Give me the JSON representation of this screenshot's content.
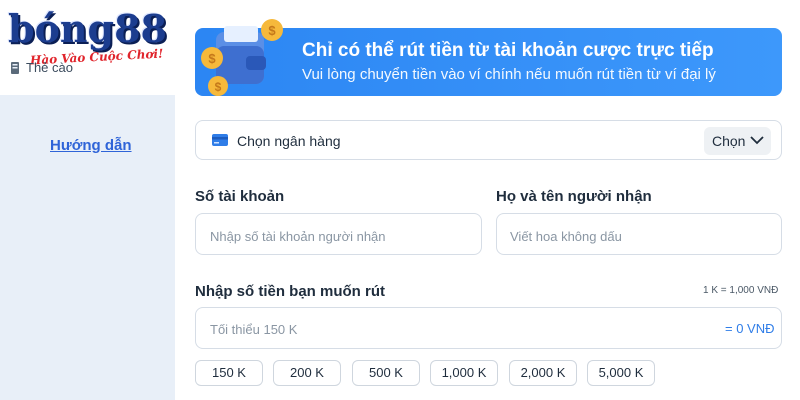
{
  "brand": {
    "logo_text": "bóng88",
    "slogan": "Hào Vào Cuộc Chơi!"
  },
  "sidebar": {
    "card_item_label": "Thẻ cào",
    "help_link": "Hướng dẫn"
  },
  "banner": {
    "title": "Chỉ có thể rút tiền từ tài khoản cược trực tiếp",
    "subtitle": "Vui lòng chuyển tiền vào ví chính nếu muốn rút tiền từ ví đại lý"
  },
  "bank": {
    "label": "Chọn ngân hàng",
    "choose_button": "Chọn"
  },
  "account": {
    "label": "Số tài khoản",
    "placeholder": "Nhập số tài khoản người nhận"
  },
  "recipient": {
    "label": "Họ và tên người nhận",
    "placeholder": "Viết hoa không dấu"
  },
  "amount": {
    "label": "Nhập số tiền bạn muốn rút",
    "rate": "1 K = 1,000 VNĐ",
    "placeholder": "Tối thiểu 150 K",
    "converted": "= 0 VNĐ"
  },
  "quick_amounts": [
    "150 K",
    "200 K",
    "500 K",
    "1,000 K",
    "2,000 K",
    "5,000 K"
  ],
  "colors": {
    "banner": "#3d98fb",
    "link": "#2f64d8",
    "sidebar_bg": "#e8eff8",
    "accent_text": "#2f7de8"
  }
}
